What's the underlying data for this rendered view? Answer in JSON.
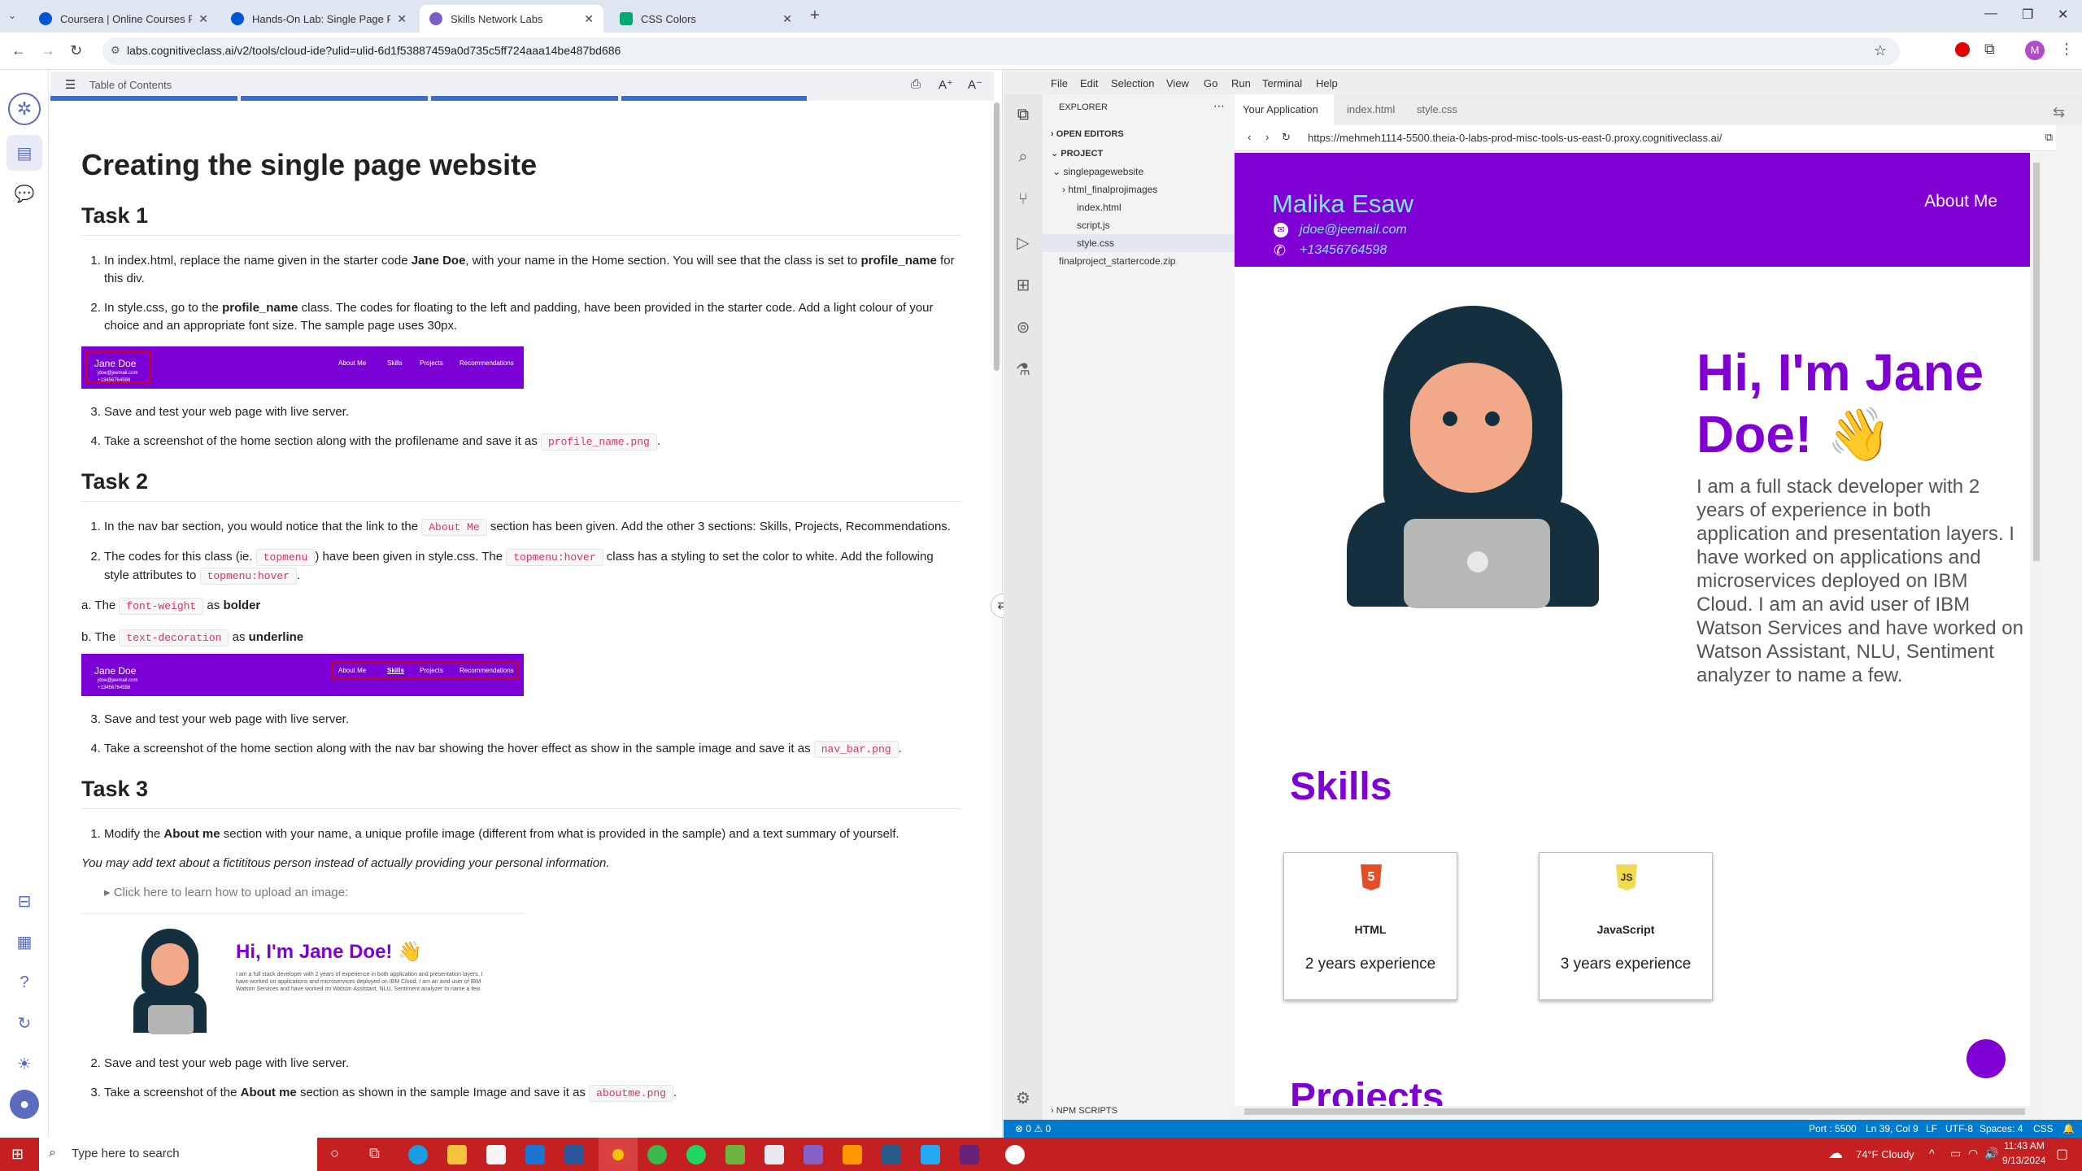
{
  "browser": {
    "tabs": [
      {
        "title": "Coursera | Online Courses From",
        "favicon_color": "#0056d2"
      },
      {
        "title": "Hands-On Lab: Single Page Por",
        "favicon_color": "#0056d2"
      },
      {
        "title": "Skills Network Labs",
        "favicon_color": "#7a5ec8"
      },
      {
        "title": "CSS Colors",
        "favicon_color": "#04aa6d"
      }
    ],
    "url": "labs.cognitiveclass.ai/v2/tools/cloud-ide?ulid=ulid-6d1f53887459a0d735c5ff724aaa14be487bd686",
    "profile_letter": "M"
  },
  "toc": {
    "label": "Table of Contents"
  },
  "doc": {
    "title": "Creating the single page website",
    "task1": {
      "heading": "Task 1",
      "s1_a": "In index.html, replace the name given in the starter code ",
      "s1_b": "Jane Doe",
      "s1_c": ", with your name in the Home section. You will see that the class is set to ",
      "s1_d": "profile_name",
      "s1_e": " for this div.",
      "s2_a": "In style.css, go to the ",
      "s2_b": "profile_name",
      "s2_c": " class. The codes for floating to the left and padding, have been provided in the starter code. Add a light colour of your choice and an appropriate font size. The sample page uses 30px.",
      "s3": "Save and test your web page with live server.",
      "s4_a": "Take a screenshot of the home section along with the profilename and save it as ",
      "s4_code": "profile_name.png",
      "s4_b": "."
    },
    "task2": {
      "heading": "Task 2",
      "s1_a": "In the nav bar section, you would notice that the link to the ",
      "s1_code": "About Me",
      "s1_b": " section has been given. Add the other 3 sections: Skills, Projects, Recommendations.",
      "s2_a": "The codes for this class (ie. ",
      "s2_code1": "topmenu",
      "s2_b": ") have been given in style.css. The ",
      "s2_code2": "topmenu:hover",
      "s2_c": " class has a styling to set the color to white. Add the following style attributes to ",
      "s2_code3": "topmenu:hover",
      "s2_d": ".",
      "a_pre": "a. The ",
      "a_code": "font-weight",
      "a_mid": " as ",
      "a_bold": "bolder",
      "b_pre": "b. The ",
      "b_code": "text-decoration",
      "b_mid": " as ",
      "b_bold": "underline",
      "s3": "Save and test your web page with live server.",
      "s4_a": "Take a screenshot of the home section along with the nav bar showing the hover effect as show in the sample image and save it as ",
      "s4_code": "nav_bar.png",
      "s4_b": "."
    },
    "task3": {
      "heading": "Task 3",
      "s1_a": "Modify the ",
      "s1_b": "About me",
      "s1_c": " section with your name, a unique profile image (different from what is provided in the sample) and a text summary of yourself.",
      "note": "You may add text about a fictititous person instead of actually providing your personal information.",
      "details": "Click here to learn how to upload an image:",
      "s2": "Save and test your web page with live server.",
      "s3_a": "Take a screenshot of the ",
      "s3_b": "About me",
      "s3_c": " section as shown in the sample Image and save it as ",
      "s3_code": "aboutme.png",
      "s3_d": "."
    },
    "sample_nav": {
      "name": "Jane Doe",
      "items": [
        "About Me",
        "Skills",
        "Projects",
        "Recommendations"
      ],
      "email": "jdoe@jeemail.com",
      "phone": "+13456764598"
    },
    "sample_about": {
      "hero": "Hi, I'm Jane Doe! 👋",
      "desc": "I am a full stack developer with 2 years of experience in both application and presentation layers. I have worked on applications and microservices deployed on IBM Cloud. I am an avid user of IBM Watson Services and have worked on Watson Assistant, NLU, Sentiment analyzer to name a few."
    }
  },
  "ide": {
    "menu": [
      "File",
      "Edit",
      "Selection",
      "View",
      "Go",
      "Run",
      "Terminal",
      "Help"
    ],
    "explorer_title": "EXPLORER",
    "open_editors": "OPEN EDITORS",
    "project": "PROJECT",
    "tree": [
      "singlepagewebsite",
      "html_finalprojimages",
      "index.html",
      "script.js",
      "style.css",
      "finalproject_startercode.zip"
    ],
    "npm_scripts": "NPM SCRIPTS",
    "tabs": [
      "Your Application",
      "index.html",
      "style.css"
    ],
    "preview_url": "https://mehmeh1114-5500.theia-0-labs-prod-misc-tools-us-east-0.proxy.cognitiveclass.ai/",
    "status": {
      "problems": "⊗ 0 ⚠ 0",
      "port": "Port : 5500",
      "position": "Ln 39, Col 9",
      "eol": "LF",
      "encoding": "UTF-8",
      "spaces": "Spaces: 4",
      "lang": "CSS"
    }
  },
  "app": {
    "name": "Malika Esaw",
    "email": "jdoe@jeemail.com",
    "phone": "+13456764598",
    "nav_about": "About Me",
    "hero": "Hi, I'm Jane Doe! 👋",
    "desc": "I am a full stack developer with 2 years of experience in both application and presentation layers. I have worked on applications and microservices deployed on IBM Cloud. I am an avid user of IBM Watson Services and have worked on Watson Assistant, NLU, Sentiment analyzer to name a few.",
    "skills_heading": "Skills",
    "skills": [
      {
        "name": "HTML",
        "exp": "2 years experience",
        "badge": "5"
      },
      {
        "name": "JavaScript",
        "exp": "3 years experience",
        "badge": "JS"
      }
    ],
    "projects_heading": "Projects",
    "accent": "#8000d4",
    "name_color": "#7ee8ff"
  },
  "taskbar": {
    "search_placeholder": "Type here to search",
    "weather": "74°F  Cloudy",
    "time": "11:43 AM",
    "date": "9/13/2024"
  }
}
